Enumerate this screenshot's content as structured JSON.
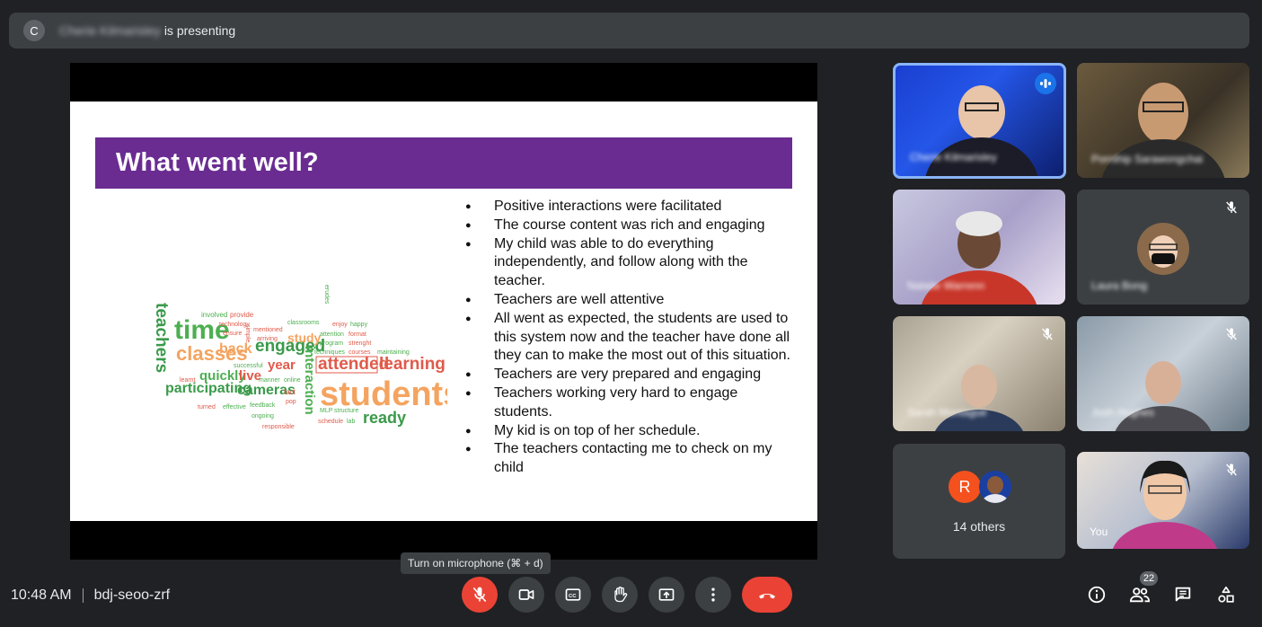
{
  "topbar": {
    "avatar_initial": "C",
    "presenter_name": "Cherie Kilmarisley",
    "presenting_suffix": "is presenting"
  },
  "slide": {
    "title": "What went well?",
    "bullets": [
      "Positive interactions were facilitated",
      "The course content was rich and engaging",
      "My child was able to do everything independently, and follow along with the teacher.",
      "Teachers  are well attentive",
      "All went as expected, the students are used to this system now and the teacher have done all they can to make the most out of this situation.",
      "Teachers are very prepared and engaging",
      "Teachers working very hard to engage students.",
      "My kid is on top of her schedule.",
      "The teachers contacting me to check on my child"
    ],
    "word_cloud": {
      "words": [
        "teachers",
        "time",
        "classes",
        "participating",
        "engaged",
        "students",
        "attended",
        "learning",
        "interaction",
        "cameras",
        "quickly",
        "live",
        "ready",
        "back",
        "year",
        "study",
        "involved",
        "provide",
        "technology",
        "ensure",
        "mentioned",
        "arriving",
        "simple",
        "successful",
        "learnt",
        "turned",
        "effective",
        "feedback",
        "ongoing",
        "responsible",
        "manner",
        "online",
        "fact",
        "pop",
        "classrooms",
        "enjoy",
        "happy",
        "attention",
        "format",
        "program",
        "strenght",
        "techniques",
        "courses",
        "maintaining",
        "MLP",
        "structure",
        "schedule",
        "lab",
        "erudes"
      ]
    }
  },
  "participants": [
    {
      "name": "Cherie Kilmarisley",
      "speaking": true,
      "muted": false
    },
    {
      "name": "Pornthip Sarawongchai",
      "speaking": false,
      "muted": false
    },
    {
      "name": "Natalie Warrenn",
      "speaking": false,
      "muted": false
    },
    {
      "name": "Laura Bong",
      "speaking": false,
      "muted": true
    },
    {
      "name": "Sarah Montague",
      "speaking": false,
      "muted": true
    },
    {
      "name": "Josh Hughes",
      "speaking": false,
      "muted": true
    },
    {
      "name": "You",
      "speaking": false,
      "muted": true
    }
  ],
  "others_tile": {
    "initial": "R",
    "label": "14 others"
  },
  "tooltip": "Turn on microphone (⌘ + d)",
  "bottom": {
    "time": "10:48 AM",
    "meeting_code": "bdj-seoo-zrf",
    "participant_count": "22"
  },
  "colors": {
    "background": "#202124",
    "surface": "#3c4043",
    "danger": "#ea4335",
    "accent": "#8ab4f8",
    "slide_header": "#6a2c91"
  },
  "icons": {
    "mic": "mic-off-icon",
    "camera": "camera-icon",
    "captions": "captions-icon",
    "raise_hand": "hand-icon",
    "present": "present-icon",
    "more": "more-vert-icon",
    "end_call": "phone-hangup-icon",
    "info": "info-icon",
    "people": "people-icon",
    "chat": "chat-icon",
    "activities": "activities-icon"
  }
}
